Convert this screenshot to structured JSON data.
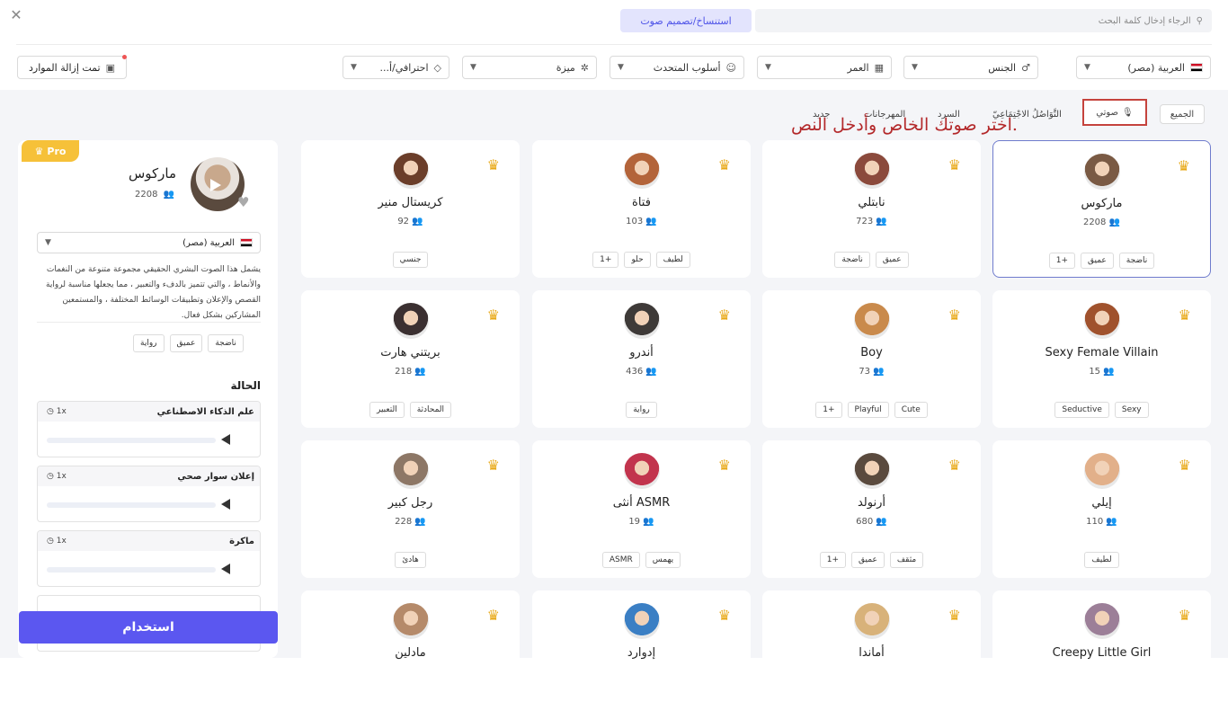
{
  "header": {
    "search_placeholder": "الرجاء إدخال كلمة البحث",
    "clone_button": "استنساخ/تصميم صوت",
    "removed_resources": "تمت إزالة الموارد"
  },
  "filters": {
    "language": "العربية (مصر)",
    "gender": "الجنس",
    "age": "العمر",
    "speaker_style": "أسلوب المتحدث",
    "feature": "ميزة",
    "professional": "احترافي/أ..."
  },
  "tabs": {
    "all": "الجميع",
    "mine": "صوتي",
    "social": "التَّوَاصُلُ الاجْتِمَاعِيّ",
    "narration": "السرد",
    "festivals": "المهرجانات",
    "new": "جديد"
  },
  "hint": "اختر صوتك الخاص وأدخل النص.",
  "voices": [
    {
      "name": "ماركوس",
      "count": "2208",
      "tags": [
        "ناضجة",
        "عميق",
        "+1"
      ],
      "color": "#7a5a44"
    },
    {
      "name": "نابتلي",
      "count": "723",
      "tags": [
        "عميق",
        "ناضجة"
      ],
      "color": "#8b4a3c"
    },
    {
      "name": "فتاة",
      "count": "103",
      "tags": [
        "لطيف",
        "حلو",
        "+1"
      ],
      "color": "#b3643a"
    },
    {
      "name": "كريستال منير",
      "count": "92",
      "tags": [
        "جنسي"
      ],
      "color": "#6b3e2a"
    },
    {
      "name": "Sexy Female Villain",
      "count": "15",
      "tags": [
        "Sexy",
        "Seductive"
      ],
      "color": "#a0522d"
    },
    {
      "name": "Boy",
      "count": "73",
      "tags": [
        "Cute",
        "Playful",
        "+1"
      ],
      "color": "#c98a4c"
    },
    {
      "name": "أندرو",
      "count": "436",
      "tags": [
        "رواية"
      ],
      "color": "#3e3a38"
    },
    {
      "name": "بريتني هارت",
      "count": "218",
      "tags": [
        "المحادثة",
        "التعبير"
      ],
      "color": "#3b3031"
    },
    {
      "name": "إيلي",
      "count": "110",
      "tags": [
        "لطيف"
      ],
      "color": "#e2b08a"
    },
    {
      "name": "أرنولد",
      "count": "680",
      "tags": [
        "مثقف",
        "عميق",
        "+1"
      ],
      "color": "#5a4a3e"
    },
    {
      "name": "أنثى ASMR",
      "count": "19",
      "tags": [
        "يهمس",
        "ASMR"
      ],
      "color": "#c2344d"
    },
    {
      "name": "رجل كبير",
      "count": "228",
      "tags": [
        "هادئ"
      ],
      "color": "#8d7766"
    },
    {
      "name": "Creepy Little Girl",
      "count": "",
      "tags": [],
      "color": "#9c7f98"
    },
    {
      "name": "أماندا",
      "count": "",
      "tags": [],
      "color": "#d8b27a"
    },
    {
      "name": "إدوارد",
      "count": "",
      "tags": [],
      "color": "#3b7fc4"
    },
    {
      "name": "مادلين",
      "count": "",
      "tags": [],
      "color": "#b58a6a"
    }
  ],
  "panel": {
    "pro": "Pro",
    "name": "ماركوس",
    "count": "2208",
    "language": "العربية (مصر)",
    "description": "يشمل هذا الصوت البشري الحقيقي مجموعة متنوعة من النغمات والأنماط ، والتي تتميز بالدفء والتعبير ، مما يجعلها مناسبة لرواية القصص والإعلان وتطبيقات الوسائط المختلفة ، والمستمعين المشاركين بشكل فعال.",
    "tags": [
      "ناضجة",
      "عميق",
      "رواية"
    ],
    "status_title": "الحالة",
    "samples": [
      {
        "title": "علم الذكاء الاصطناعي",
        "speed": "1x"
      },
      {
        "title": "إعلان سوار صحي",
        "speed": "1x"
      },
      {
        "title": "ماكرة",
        "speed": "1x"
      }
    ],
    "use_button": "استخدام"
  }
}
